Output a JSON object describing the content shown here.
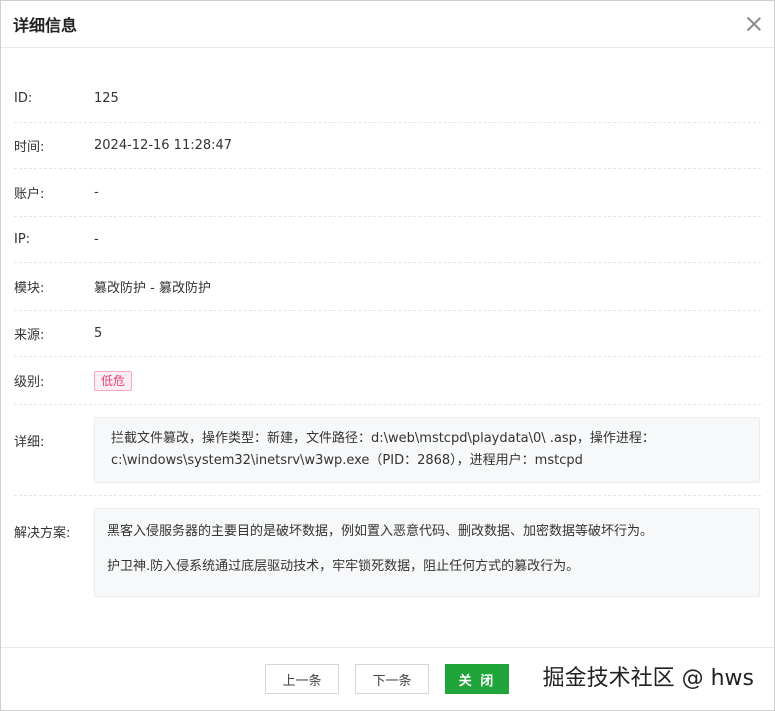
{
  "dialog": {
    "title": "详细信息"
  },
  "rows": {
    "id": {
      "label": "ID:",
      "value": "125"
    },
    "time": {
      "label": "时间:",
      "value": "2024-12-16 11:28:47"
    },
    "account": {
      "label": "账户:",
      "value": "-"
    },
    "ip": {
      "label": "IP:",
      "value": "-"
    },
    "module": {
      "label": "模块:",
      "value": "篡改防护 - 篡改防护"
    },
    "source": {
      "label": "来源:",
      "value": "5"
    },
    "level": {
      "label": "级别:",
      "value": "低危"
    },
    "detail": {
      "label": "详细:",
      "value": "拦截文件篡改，操作类型：新建，文件路径：d:\\web\\mstcpd\\playdata\\0\\ .asp，操作进程：c:\\windows\\system32\\inetsrv\\w3wp.exe（PID：2868），进程用户：mstcpd"
    },
    "solution": {
      "label": "解决方案:",
      "lines": [
        "黑客入侵服务器的主要目的是破坏数据，例如置入恶意代码、删改数据、加密数据等破坏行为。",
        "护卫神.防入侵系统通过底层驱动技术，牢牢锁死数据，阻止任何方式的篡改行为。"
      ]
    }
  },
  "footer": {
    "prev_label": "上一条",
    "next_label": "下一条",
    "close_label": "关 闭"
  },
  "watermark": "掘金技术社区 @ hws",
  "colors": {
    "primary": "#20a53a",
    "badge_text": "#e0407a",
    "badge_bg": "#fdeef3"
  }
}
